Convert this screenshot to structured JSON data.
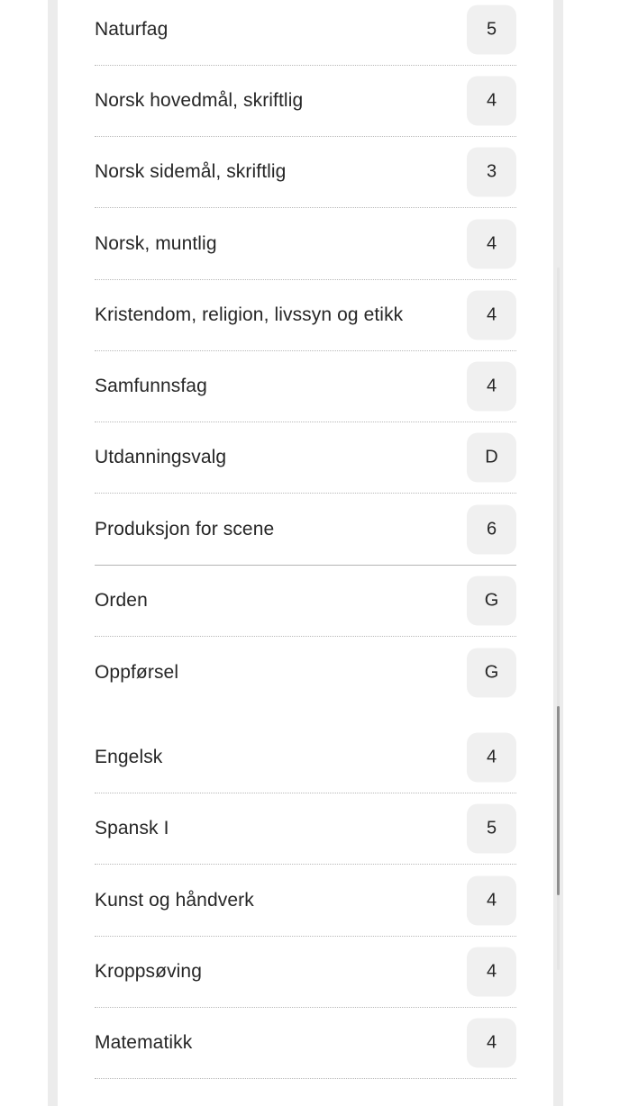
{
  "groups": [
    {
      "rows": [
        {
          "subject": "Naturfag",
          "grade": "5"
        },
        {
          "subject": "Norsk hovedmål, skriftlig",
          "grade": "4"
        },
        {
          "subject": "Norsk sidemål, skriftlig",
          "grade": "3"
        },
        {
          "subject": "Norsk, muntlig",
          "grade": "4"
        },
        {
          "subject": "Kristendom, religion, livssyn og etikk",
          "grade": "4"
        },
        {
          "subject": "Samfunnsfag",
          "grade": "4"
        },
        {
          "subject": "Utdanningsvalg",
          "grade": "D"
        },
        {
          "subject": "Produksjon for scene",
          "grade": "6"
        }
      ]
    },
    {
      "rows": [
        {
          "subject": "Orden",
          "grade": "G"
        },
        {
          "subject": "Oppførsel",
          "grade": "G"
        }
      ]
    },
    {
      "rows": [
        {
          "subject": "Engelsk",
          "grade": "4"
        },
        {
          "subject": "Spansk I",
          "grade": "5"
        },
        {
          "subject": "Kunst og håndverk",
          "grade": "4"
        },
        {
          "subject": "Kroppsøving",
          "grade": "4"
        },
        {
          "subject": "Matematikk",
          "grade": "4"
        }
      ]
    }
  ]
}
